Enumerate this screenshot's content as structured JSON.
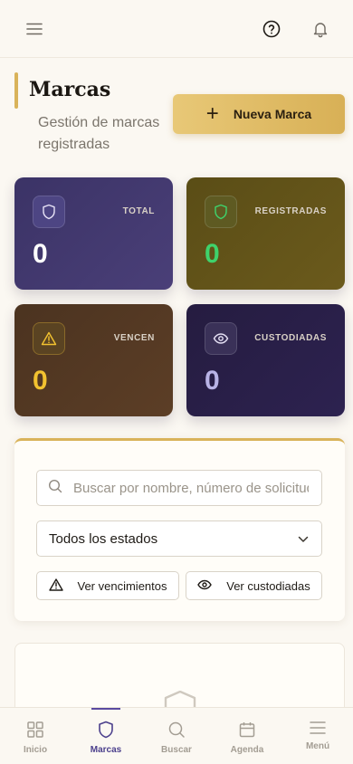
{
  "topbar": {
    "menu_icon": "hamburger-menu-icon",
    "help_icon": "help-circle-icon",
    "bell_icon": "bell-icon"
  },
  "header": {
    "title": "Marcas",
    "subtitle": "Gestión de marcas registradas",
    "new_button_label": "Nueva Marca"
  },
  "stats": [
    {
      "label": "TOTAL",
      "value": "0",
      "icon": "shield-icon",
      "value_color": "#ffffff"
    },
    {
      "label": "REGISTRADAS",
      "value": "0",
      "icon": "shield-check-icon",
      "value_color": "#3fd26b"
    },
    {
      "label": "VENCEN",
      "value": "0",
      "icon": "warning-triangle-icon",
      "value_color": "#f2c230"
    },
    {
      "label": "CUSTODIADAS",
      "value": "0",
      "icon": "eye-icon",
      "value_color": "#b9b3e6"
    }
  ],
  "filters": {
    "search_placeholder": "Buscar por nombre, número de solicitud...",
    "search_value": "",
    "status_selected": "Todos los estados",
    "vencimientos_label": "Ver vencimientos",
    "custodiadas_label": "Ver custodiadas"
  },
  "bottom_nav": [
    {
      "label": "Inicio",
      "icon": "grid-icon",
      "active": false
    },
    {
      "label": "Marcas",
      "icon": "shield-icon",
      "active": true
    },
    {
      "label": "Buscar",
      "icon": "search-icon",
      "active": false
    },
    {
      "label": "Agenda",
      "icon": "calendar-icon",
      "active": false
    },
    {
      "label": "Menú",
      "icon": "menu-icon",
      "active": false
    }
  ],
  "colors": {
    "accent_gold": "#d9b35a",
    "brand_purple": "#4b3f8c",
    "background": "#fbf8f2"
  }
}
